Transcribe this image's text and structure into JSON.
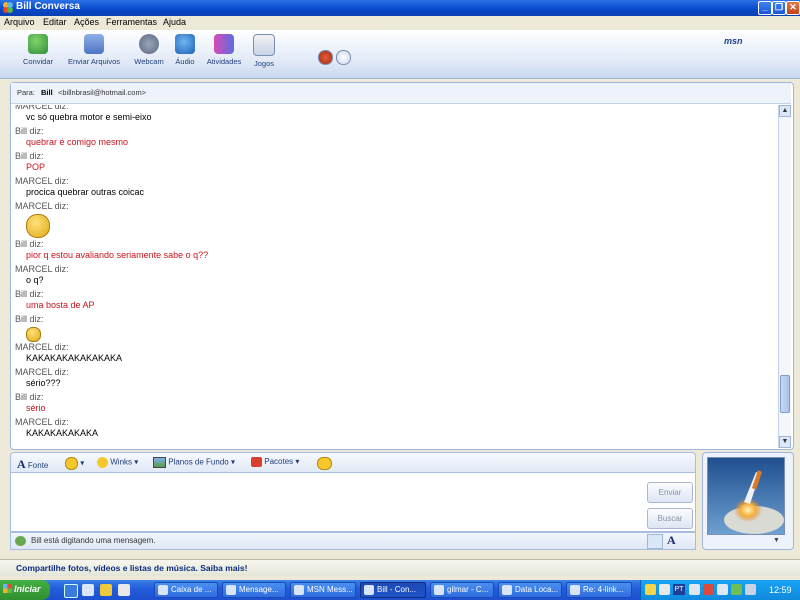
{
  "window": {
    "title": "Bill   Conversa",
    "controls": [
      "_",
      "❐",
      "✕"
    ]
  },
  "menu": [
    "Arquivo",
    "Editar",
    "Ações",
    "Ferramentas",
    "Ajuda"
  ],
  "toolbar": {
    "buttons": [
      "Convidar",
      "Enviar Arquivos",
      "Webcam",
      "Áudio",
      "Atividades",
      "Jogos"
    ],
    "logo": "msn"
  },
  "to": {
    "label": "Para:",
    "name": "Bill",
    "email": "<billnbrasil@hotmail.com>"
  },
  "history": [
    {
      "type": "sender",
      "text": "MARCEL diz:"
    },
    {
      "type": "msg",
      "text": "vc só quebra motor e semi-eixo",
      "color": "black"
    },
    {
      "type": "sender",
      "text": "Bill diz:"
    },
    {
      "type": "msg",
      "text": "quebrar é comigo mesmo",
      "color": "red"
    },
    {
      "type": "sender",
      "text": "Bill diz:"
    },
    {
      "type": "msg",
      "text": "POP",
      "color": "red"
    },
    {
      "type": "sender",
      "text": "MARCEL diz:"
    },
    {
      "type": "msg",
      "text": "procica quebrar outras coicac",
      "color": "black"
    },
    {
      "type": "sender",
      "text": "MARCEL diz:"
    },
    {
      "type": "emoticon",
      "icon": "winking-emoticon-icon"
    },
    {
      "type": "sender",
      "text": "Bill diz:"
    },
    {
      "type": "msg",
      "text": "pior q estou avaliando seriamente sabe o q??",
      "color": "red"
    },
    {
      "type": "sender",
      "text": "MARCEL diz:"
    },
    {
      "type": "msg",
      "text": "o q?",
      "color": "black"
    },
    {
      "type": "sender",
      "text": "Bill diz:"
    },
    {
      "type": "msg",
      "text": "uma bosta de AP",
      "color": "red"
    },
    {
      "type": "sender",
      "text": "Bill diz:"
    },
    {
      "type": "emoticon",
      "icon": "laughing-emoticon-icon"
    },
    {
      "type": "sender",
      "text": "MARCEL diz:"
    },
    {
      "type": "msg",
      "text": "KAKAKAKAKAKAKAKA",
      "color": "black"
    },
    {
      "type": "sender",
      "text": "MARCEL diz:"
    },
    {
      "type": "msg",
      "text": "sério???",
      "color": "black"
    },
    {
      "type": "sender",
      "text": "Bill diz:"
    },
    {
      "type": "msg",
      "text": "sério",
      "color": "red"
    },
    {
      "type": "sender",
      "text": "MARCEL diz:"
    },
    {
      "type": "msg",
      "text": "KAKAKAKAKAKA",
      "color": "black"
    }
  ],
  "format_bar": {
    "font": "Fonte",
    "winks": "Winks",
    "backgrounds": "Planos de Fundo",
    "packs": "Pacotes"
  },
  "compose": {
    "send": "Enviar",
    "search": "Buscar"
  },
  "status": {
    "typing": "Bill está digitando uma mensagem."
  },
  "banner": {
    "text": "Compartilhe fotos, vídeos e listas de música. Saiba mais!"
  },
  "taskbar": {
    "start": "Iniciar",
    "tasks": [
      "Caixa de ...",
      "Mensage...",
      "MSN Mess...",
      "Bill - Con...",
      "gilmar - C...",
      "Data Loca...",
      "Re: 4-link..."
    ],
    "active_index": 3,
    "language": "PT",
    "clock": "12:59"
  },
  "colors": {
    "title": "#0a3fb0",
    "red_text": "#c8141e",
    "banner_text": "#0b2c80",
    "start": "#2e8f2e"
  }
}
